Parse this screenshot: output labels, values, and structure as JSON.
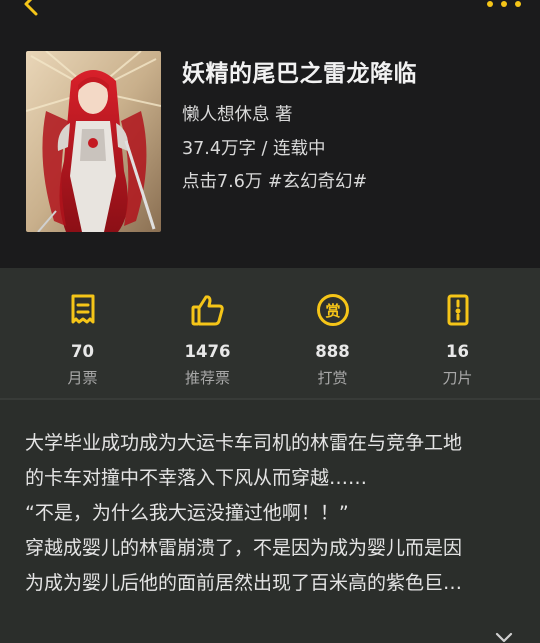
{
  "book": {
    "title": "妖精的尾巴之雷龙降临",
    "author_line": "懒人想休息 著",
    "words_status": "37.4万字 / 连载中",
    "clicks_tags": "点击7.6万 #玄幻奇幻#"
  },
  "stats": [
    {
      "icon": "monthly-ticket-icon",
      "value": "70",
      "label": "月票"
    },
    {
      "icon": "thumbs-up-icon",
      "value": "1476",
      "label": "推荐票"
    },
    {
      "icon": "reward-icon",
      "value": "888",
      "label": "打赏"
    },
    {
      "icon": "blade-icon",
      "value": "16",
      "label": "刀片"
    }
  ],
  "description": [
    "大学毕业成功成为大运卡车司机的林雷在与竞争工地",
    "的卡车对撞中不幸落入下风从而穿越……",
    "“不是，为什么我大运没撞过他啊！！”",
    "穿越成婴儿的林雷崩溃了，不是因为成为婴儿而是因",
    "为成为婴儿后他的面前居然出现了百米高的紫色巨…"
  ],
  "colors": {
    "accent": "#f5c518",
    "header_bg": "#1b1b1c",
    "panel_bg": "#2e312e"
  }
}
